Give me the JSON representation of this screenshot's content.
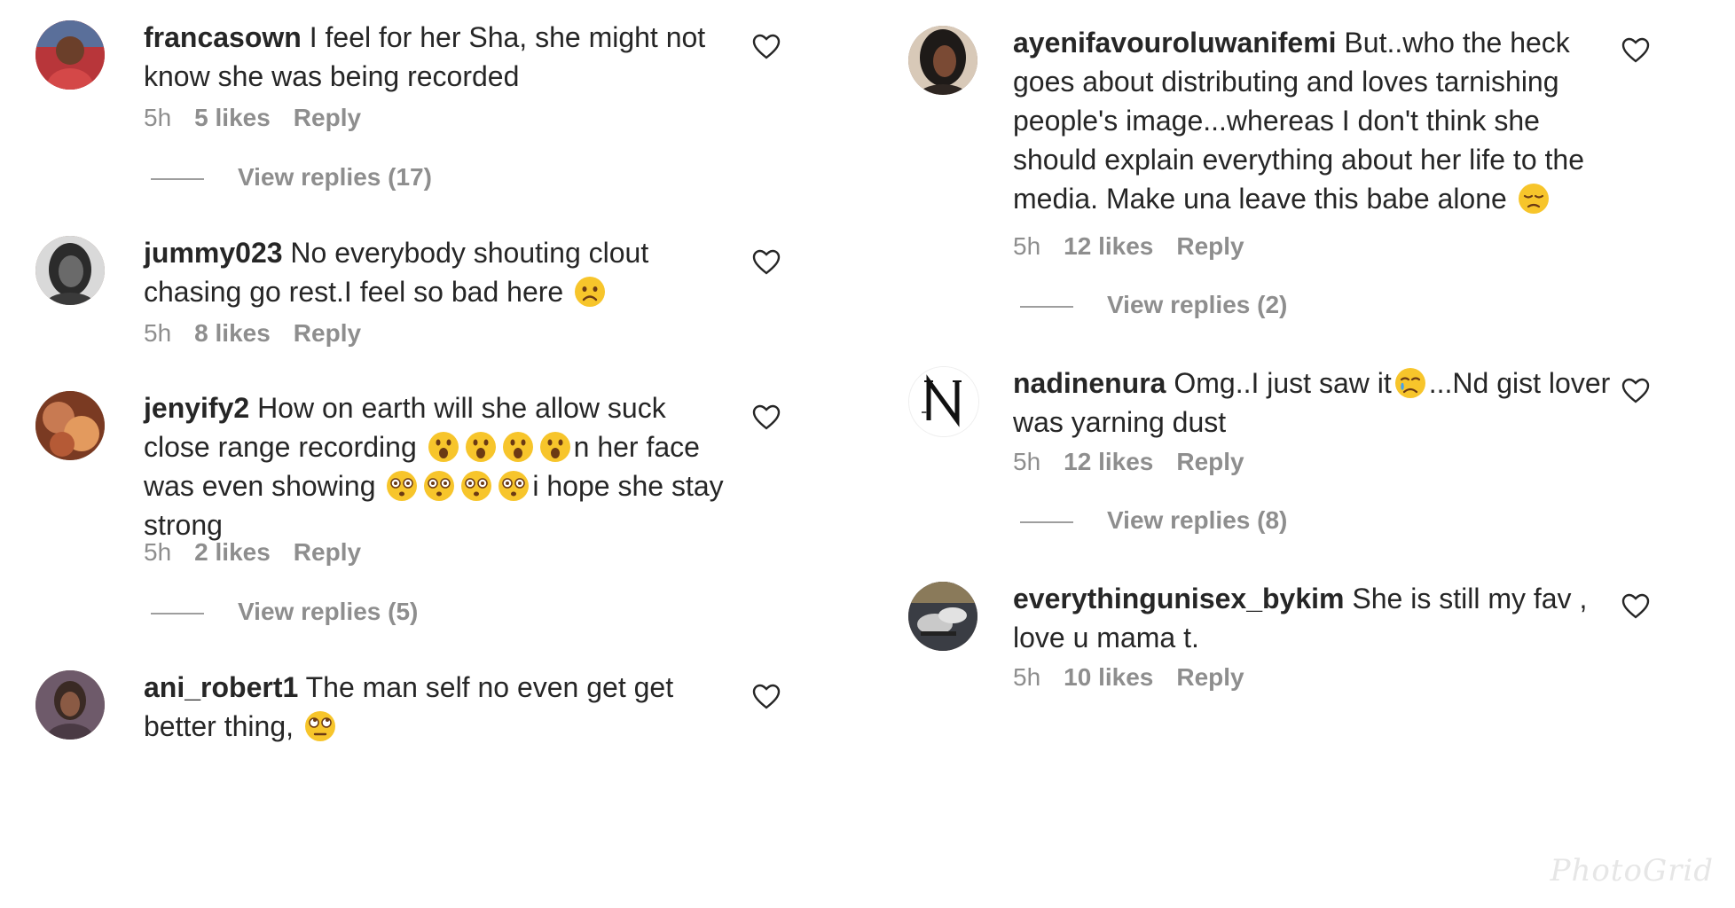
{
  "comments_left": [
    {
      "username": "francasown",
      "text": "I feel for her Sha, she might not know she was being recorded",
      "time": "5h",
      "likes": "5 likes",
      "reply": "Reply",
      "view_replies": "View replies (17)",
      "avatar": "avatar-woman-red"
    },
    {
      "username": "jummy023",
      "text": "No everybody shouting clout chasing go rest.I feel so bad here",
      "time": "5h",
      "likes": "8 likes",
      "reply": "Reply",
      "avatar": "avatar-woman-bw"
    },
    {
      "username": "jenyify2",
      "text_part1": "How on earth will she allow suck close range recording",
      "text_part2": "n her face was even showing",
      "text_part3": "i hope she stay strong",
      "time": "5h",
      "likes": "2 likes",
      "reply": "Reply",
      "view_replies": "View replies (5)",
      "avatar": "avatar-photo-warm"
    },
    {
      "username": "ani_robert1",
      "text": "The man self no even get get better thing,",
      "avatar": "avatar-woman-portrait"
    }
  ],
  "comments_right": [
    {
      "username": "ayenifavouroluwanifemi",
      "text": "But..who the heck goes about distributing and loves tarnishing people's image...whereas I don't think she should explain everything about her life to the media. Make una leave this babe alone",
      "time": "5h",
      "likes": "12 likes",
      "reply": "Reply",
      "view_replies": "View replies (2)",
      "avatar": "avatar-woman-dark"
    },
    {
      "username": "nadinenura",
      "text_part1": "Omg..I just saw it",
      "text_part2": "...Nd gist lover was yarning dust",
      "time": "5h",
      "likes": "12 likes",
      "reply": "Reply",
      "view_replies": "View replies (8)",
      "avatar": "avatar-logo-n"
    },
    {
      "username": "everythingunisex_bykim",
      "text": "She is still my fav , love u mama t.",
      "time": "5h",
      "likes": "10 likes",
      "reply": "Reply",
      "avatar": "avatar-shoes"
    }
  ],
  "watermark": "PhotoGrid",
  "icons": {
    "heart": "heart-outline-icon",
    "emoji_sad": "disappointed-face-icon",
    "emoji_frown": "frowning-face-icon",
    "emoji_open_mouth": "open-mouth-face-icon",
    "emoji_flushed": "flushed-face-icon",
    "emoji_crying": "crying-face-icon",
    "emoji_eye_roll": "eye-roll-face-icon"
  },
  "colors": {
    "text": "#262626",
    "meta": "#8e8e8e",
    "emoji": "#f7c52b"
  }
}
